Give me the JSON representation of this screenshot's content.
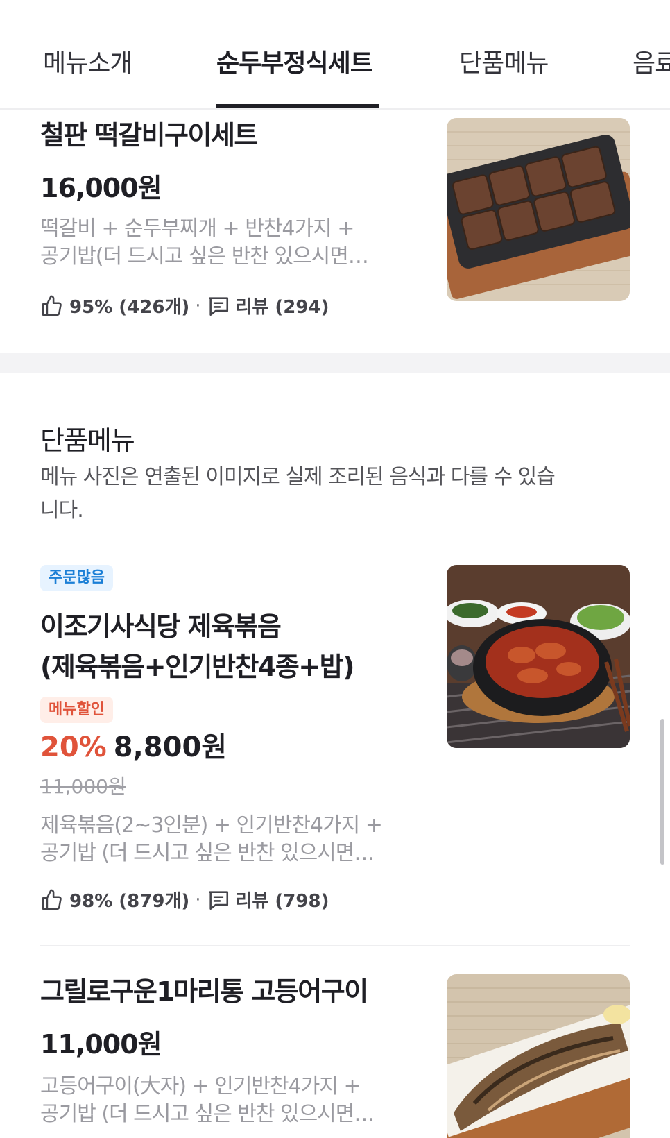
{
  "tabs": [
    {
      "label": "메뉴소개"
    },
    {
      "label": "순두부정식세트"
    },
    {
      "label": "단품메뉴"
    },
    {
      "label": "음료"
    }
  ],
  "items": [
    {
      "name": "철판 떡갈비구이세트",
      "price": "16,000원",
      "desc_line1": "떡갈비 + 순두부찌개 + 반찬4가지 +",
      "desc_line2": "공기밥(더 드시고 싶은 반찬 있으시면…",
      "rating": "95% (426개)",
      "reviews": "리뷰 (294)"
    },
    {
      "badge": "주문많음",
      "name_line1": "이조기사식당 제육볶음",
      "name_line2": "(제육볶음+인기반찬4종+밥)",
      "discount_badge": "메뉴할인",
      "discount": "20%",
      "price": "8,800원",
      "original_price": "11,000원",
      "desc_line1": "제육볶음(2~3인분) + 인기반찬4가지 +",
      "desc_line2": "공기밥 (더 드시고 싶은 반찬 있으시면…",
      "rating": "98% (879개)",
      "reviews": "리뷰 (798)"
    },
    {
      "name": "그릴로구운1마리통 고등어구이",
      "price": "11,000원",
      "desc_line1": "고등어구이(大자) + 인기반찬4가지 +",
      "desc_line2": "공기밥 (더 드시고 싶은 반찬 있으시면…"
    }
  ],
  "section": {
    "title": "단품메뉴",
    "note": "메뉴 사진은 연출된 이미지로 실제 조리된 음식과 다를 수 있습니다."
  },
  "separator": "·",
  "colors": {
    "accent_red": "#e0533a",
    "badge_blue": "#1b7fd6",
    "text_dark": "#1f1f25",
    "text_muted": "#9a9aa0"
  }
}
